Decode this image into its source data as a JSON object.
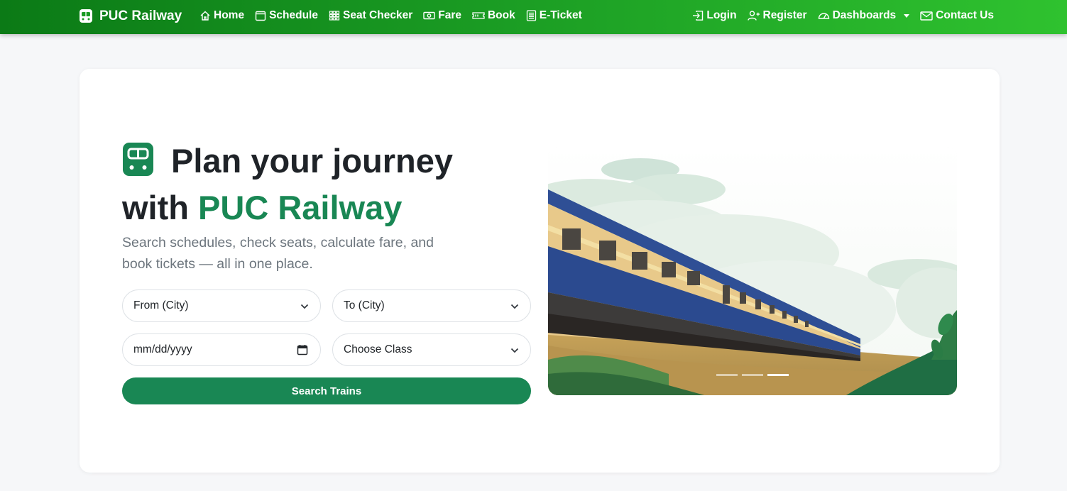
{
  "navbar": {
    "brand": "PUC Railway",
    "left_links": [
      {
        "label": "Home",
        "icon": "home-icon"
      },
      {
        "label": "Schedule",
        "icon": "calendar-icon"
      },
      {
        "label": "Seat Checker",
        "icon": "grid-icon"
      },
      {
        "label": "Fare",
        "icon": "cash-icon"
      },
      {
        "label": "Book",
        "icon": "ticket-icon"
      },
      {
        "label": "E-Ticket",
        "icon": "document-icon"
      }
    ],
    "right_links": [
      {
        "label": "Login",
        "icon": "login-icon"
      },
      {
        "label": "Register",
        "icon": "person-add-icon"
      },
      {
        "label": "Dashboards",
        "icon": "speedometer-icon",
        "dropdown": true
      },
      {
        "label": "Contact Us",
        "icon": "envelope-icon"
      }
    ],
    "gradient": [
      "#0b7a16",
      "#2fc22f"
    ]
  },
  "hero": {
    "title_line1": "Plan your journey",
    "title_with": "with",
    "title_brand": "PUC Railway",
    "subtitle": "Search schedules, check seats, calculate fare, and book tickets — all in one place.",
    "accent_color": "#198754"
  },
  "form": {
    "from_label": "From (City)",
    "to_label": "To (City)",
    "date_placeholder": "mm/dd/yyyy",
    "class_label": "Choose Class",
    "search_button": "Search Trains"
  },
  "carousel": {
    "slide_count": 3,
    "active_index": 2
  }
}
